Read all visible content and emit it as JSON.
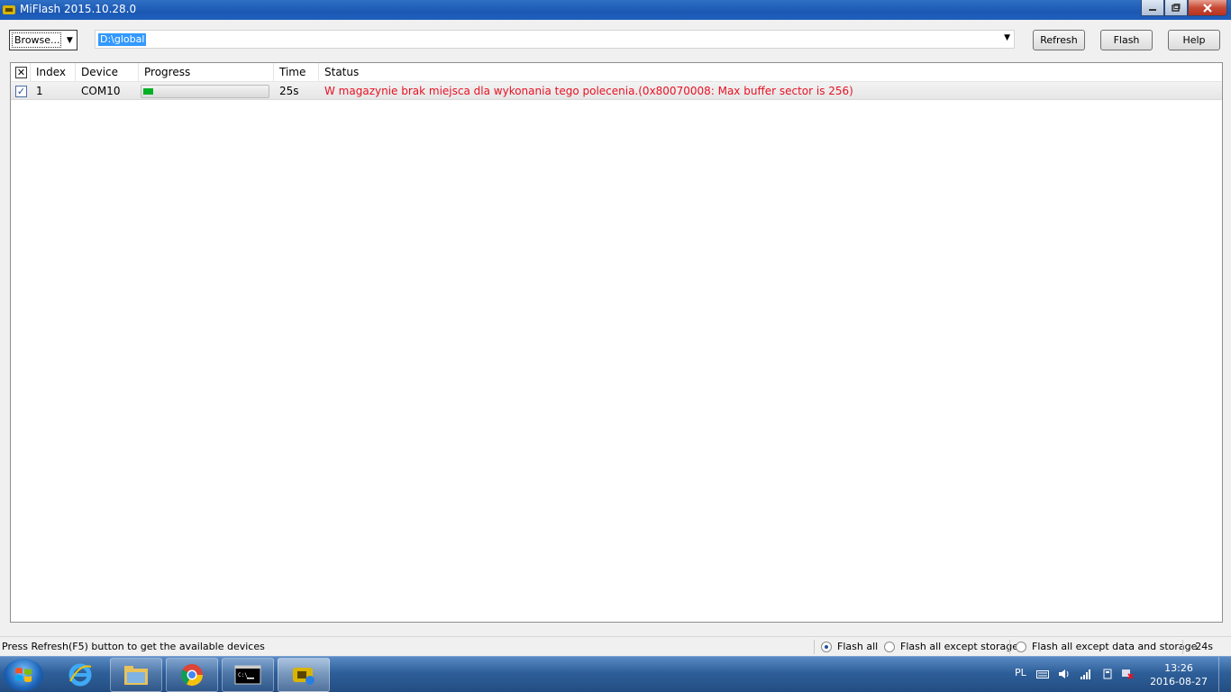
{
  "window": {
    "title": "MiFlash 2015.10.28.0",
    "controls": {
      "minimize": "_",
      "maximize": "▫",
      "close": "x"
    }
  },
  "toolbar": {
    "browse_label": "Browse...",
    "path_value": "D:\\global",
    "refresh_label": "Refresh",
    "flash_label": "Flash",
    "help_label": "Help"
  },
  "table": {
    "columns": [
      "Index",
      "Device",
      "Progress",
      "Time",
      "Status"
    ],
    "rows": [
      {
        "checked": true,
        "index": "1",
        "device": "COM10",
        "progress": 0.08,
        "time": "25s",
        "status": "W magazynie brak miejsca dla wykonania tego polecenia.(0x80070008: Max buffer sector is 256)",
        "status_color": "#e81123"
      }
    ]
  },
  "statusbar": {
    "message": "Press Refresh(F5) button to get the available devices",
    "options": [
      "Flash all",
      "Flash all except storage",
      "Flash all except data and storage"
    ],
    "selected_option": "Flash all",
    "elapsed": "24s"
  },
  "taskbar": {
    "apps": [
      "internet-explorer",
      "file-explorer",
      "chrome",
      "command-prompt",
      "miflash"
    ],
    "language": "PL",
    "time": "13:26",
    "date": "2016-08-27"
  },
  "colors": {
    "titlebar": "#1b58b3",
    "progress_fill": "#06b025",
    "error_text": "#e81123",
    "selection": "#3399ff"
  }
}
